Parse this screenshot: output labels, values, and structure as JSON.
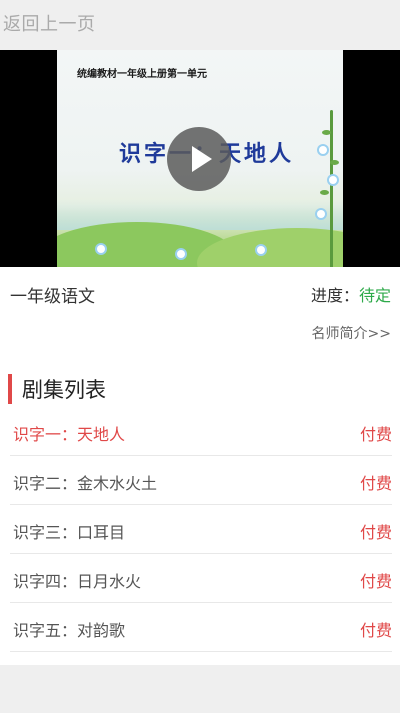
{
  "nav": {
    "back_label": "返回上一页"
  },
  "video": {
    "poster_subtitle": "统编教材一年级上册第一单元",
    "poster_title": "识字一：天地人"
  },
  "course": {
    "title": "一年级语文",
    "progress_label": "进度：",
    "progress_value": "待定",
    "teacher_intro": "名师简介>>"
  },
  "episode_list": {
    "title": "剧集列表",
    "items": [
      {
        "name": "识字一：天地人",
        "price": "付费",
        "active": true
      },
      {
        "name": "识字二：金木水火土",
        "price": "付费",
        "active": false
      },
      {
        "name": "识字三：口耳目",
        "price": "付费",
        "active": false
      },
      {
        "name": "识字四：日月水火",
        "price": "付费",
        "active": false
      },
      {
        "name": "识字五：对韵歌",
        "price": "付费",
        "active": false
      }
    ]
  },
  "colors": {
    "accent": "#e04848",
    "progress": "#2eaa4a",
    "background": "#efefef"
  }
}
